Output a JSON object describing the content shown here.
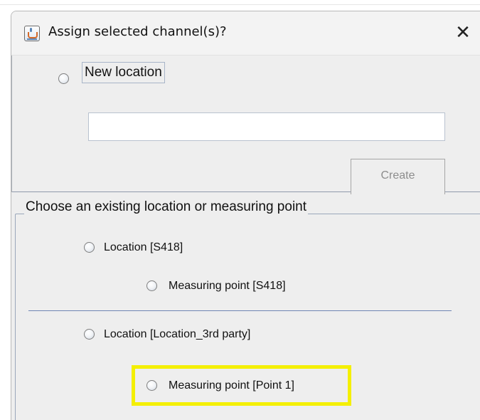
{
  "dialog": {
    "title": "Assign selected channel(s)?",
    "close_glyph": "✕",
    "icon": "java-cup-icon"
  },
  "new_location": {
    "radio_label": "New location",
    "input_value": "",
    "create_label": "Create",
    "create_enabled": false
  },
  "existing": {
    "group_title": "Choose an existing location or measuring point",
    "options": [
      {
        "label": "Location [S418]",
        "selected": false
      },
      {
        "label": "Measuring point [S418]",
        "selected": false
      },
      {
        "label": "Location [Location_3rd party]",
        "selected": false
      },
      {
        "label": "Measuring point [Point 1]",
        "selected": false,
        "highlighted": true
      }
    ]
  },
  "colors": {
    "highlight": "#f4ef00",
    "dialog_bg": "#eeeeee",
    "separator": "#6f86b3"
  }
}
